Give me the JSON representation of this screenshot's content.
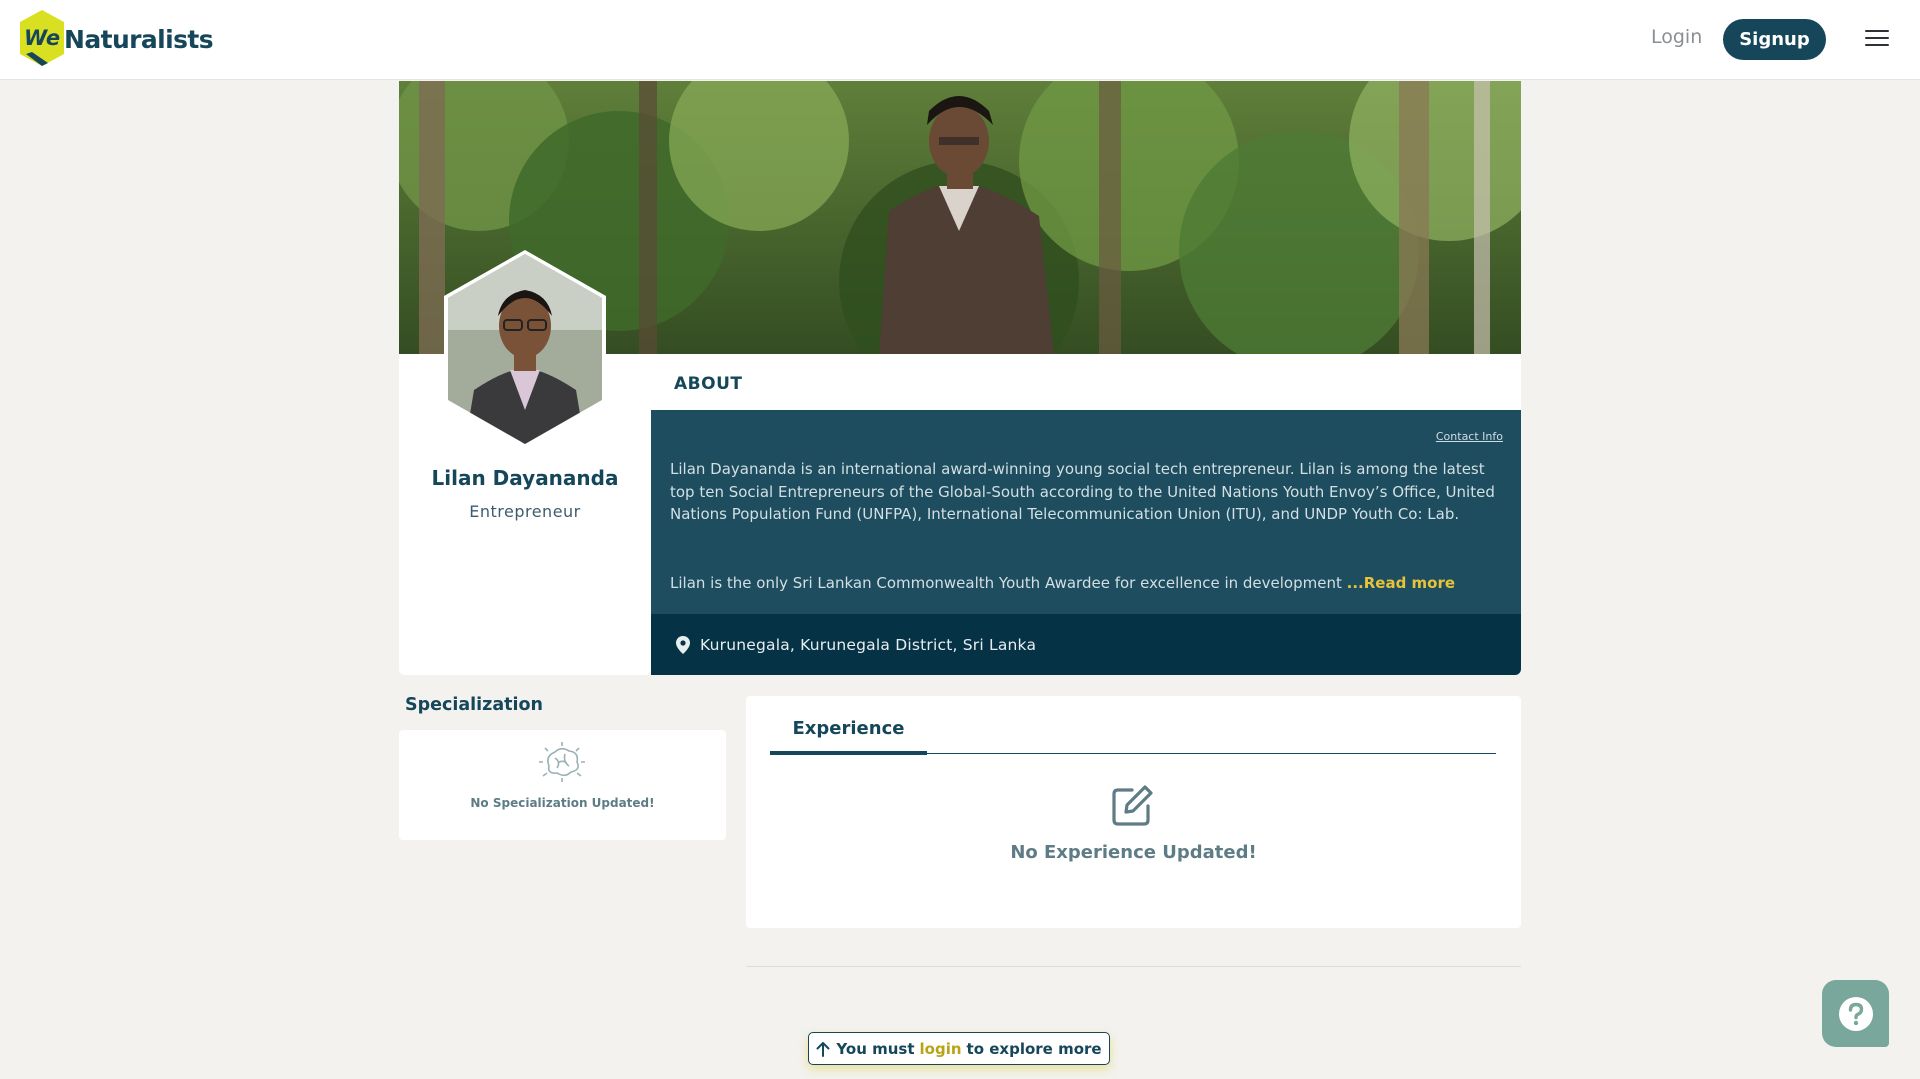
{
  "header": {
    "logo_we": "We",
    "logo_text": "Naturalists",
    "login_label": "Login",
    "signup_label": "Signup"
  },
  "profile": {
    "name": "Lilan Dayananda",
    "role": "Entrepreneur"
  },
  "about": {
    "title": "ABOUT",
    "contact_link": "Contact Info",
    "bio_paragraph_1": "Lilan Dayananda is an international award-winning young social tech entrepreneur. Lilan is among the latest top ten Social Entrepreneurs of the Global-South according to the United Nations Youth Envoy’s Office, United Nations Population Fund (UNFPA), International Telecommunication Union (ITU), and UNDP Youth Co: Lab.",
    "bio_paragraph_2": "Lilan is the only Sri Lankan Commonwealth Youth Awardee for excellence in development",
    "read_more": "...Read more",
    "location": "Kurunegala, Kurunegala District, Sri Lanka"
  },
  "specialization": {
    "title": "Specialization",
    "empty_text": "No Specialization Updated!"
  },
  "experience": {
    "tab_label": "Experience",
    "empty_text": "No Experience Updated!"
  },
  "login_prompt": {
    "prefix": "You must",
    "link": "login",
    "suffix": "to explore more"
  },
  "icons": {
    "logo": "we-naturalists-hex-logo",
    "menu": "hamburger-menu-icon",
    "location": "map-pin-icon",
    "specialization_empty": "brain-icon",
    "experience_empty": "edit-icon",
    "login_arrow": "arrow-up-icon",
    "help": "question-circle-icon"
  },
  "colors": {
    "brand_dark": "#16465a",
    "about_bg": "#1d4d5e",
    "location_bg": "#063246",
    "accent_yellow": "#e8c33a",
    "help_button": "#7aa79b"
  }
}
